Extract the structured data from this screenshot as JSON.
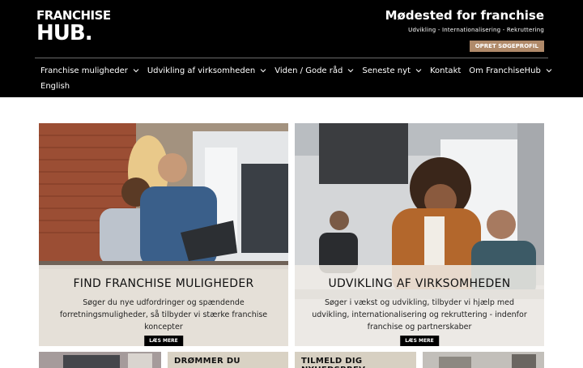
{
  "header": {
    "logo_top": "FRANCHISE",
    "logo_bottom": "HUB.",
    "tagline": "Mødested for franchise",
    "subtag": "Udvikling - Internationalisering - Rekruttering",
    "cta_label": "OPRET SØGEPROFIL"
  },
  "nav": {
    "items": [
      {
        "label": "Franchise muligheder",
        "icon": "chevron-down-icon"
      },
      {
        "label": "Udvikling af virksomheden",
        "icon": "chevron-down-icon"
      },
      {
        "label": "Viden / Gode råd",
        "icon": "chevron-down-icon"
      },
      {
        "label": "Seneste nyt",
        "icon": "chevron-down-icon"
      },
      {
        "label": "Kontakt"
      },
      {
        "label": "Om FranchiseHub",
        "icon": "chevron-down-icon"
      },
      {
        "label": "English"
      }
    ]
  },
  "cards": [
    {
      "title": "FIND FRANCHISE MULIGHEDER",
      "text": "Søger du nye udfordringer og spændende forretningsmuligheder, så tilbyder vi stærke franchise koncepter",
      "button": "LÆS MERE"
    },
    {
      "title": "UDVIKLING AF VIRKSOMHEDEN",
      "text": "Søger i vækst og udvikling, tilbyder vi hjælp med udvikling, internationalisering og rekruttering - indenfor franchise og partnerskaber",
      "button": "LÆS MERE"
    }
  ],
  "bottom_cards": [
    {
      "title": ""
    },
    {
      "title": "DRØMMER DU"
    },
    {
      "title": "TILMELD DIG NYHEDSBREV"
    },
    {
      "title": ""
    }
  ],
  "colors": {
    "header_bg": "#000000",
    "cta_bg": "#b08a6a",
    "overlay": "#f0ece6"
  }
}
